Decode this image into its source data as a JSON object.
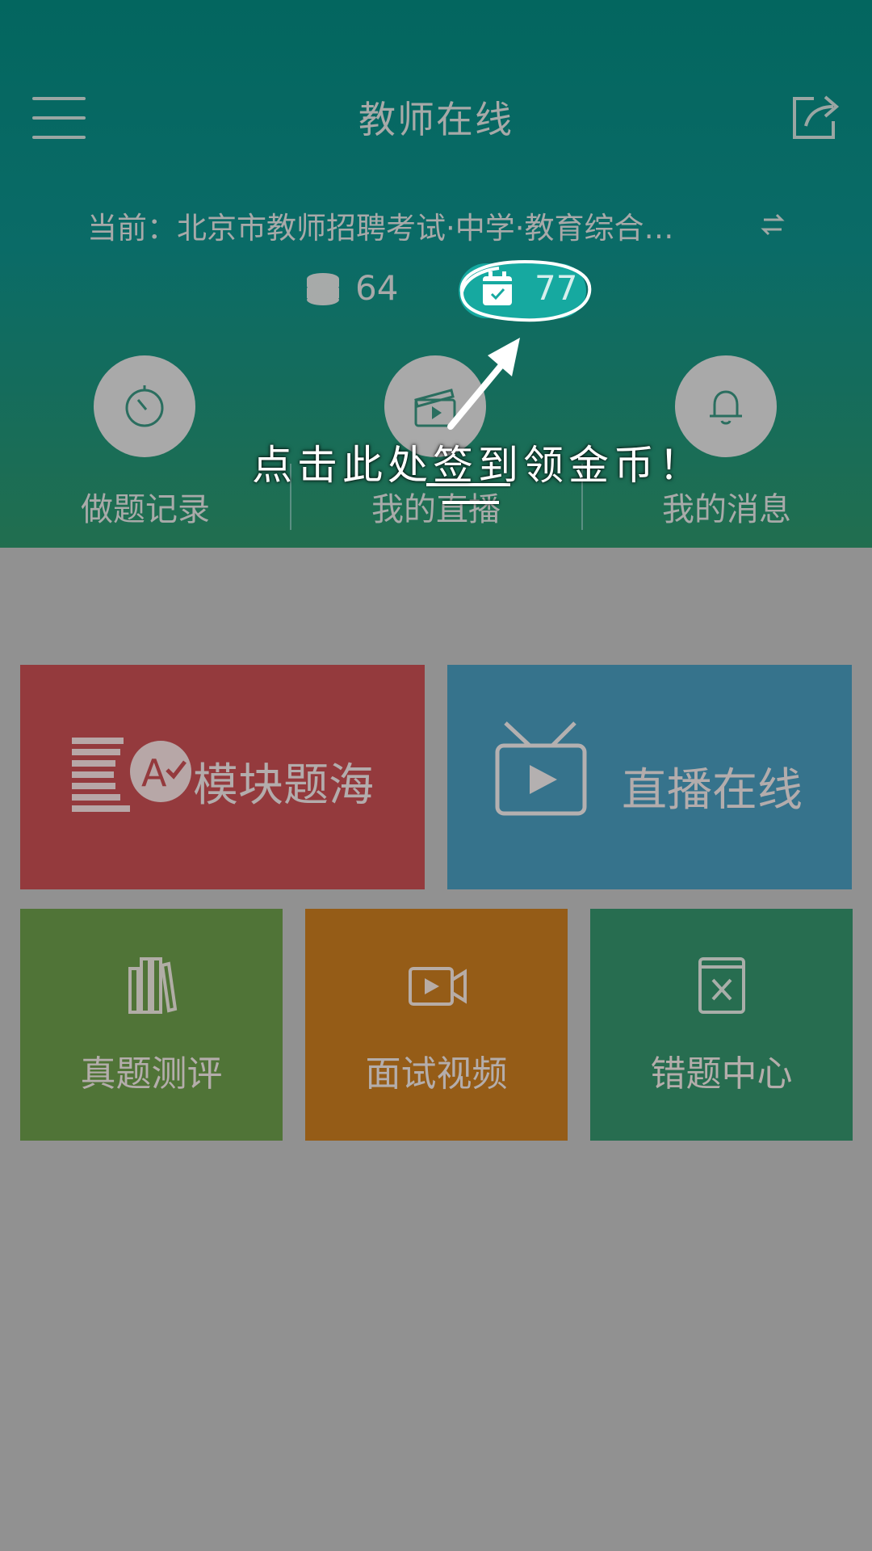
{
  "header": {
    "title": "教师在线",
    "current_prefix": "当前：",
    "current_exam": "北京市教师招聘考试·中学·教育综合…",
    "coins": "64",
    "sign_days": "77"
  },
  "quick": [
    {
      "label": "做题记录",
      "icon": "timer-icon"
    },
    {
      "label": "我的直播",
      "icon": "clapperboard-icon"
    },
    {
      "label": "我的消息",
      "icon": "bell-icon"
    }
  ],
  "annotation": "点击此处签到领金币！",
  "tiles": {
    "module": "模块题海",
    "live": "直播在线",
    "real_exam": "真题测评",
    "interview": "面试视频",
    "wrong": "错题中心"
  },
  "colors": {
    "header_top": "#03665f",
    "header_bottom": "#216e4f",
    "overlay_gray": "#919191",
    "tile_red": "#943a3d",
    "tile_blue": "#36738c",
    "tile_green": "#507437",
    "tile_orange": "#955c17",
    "tile_dark_green": "#276d50",
    "sign_accent": "#16a9a0"
  }
}
